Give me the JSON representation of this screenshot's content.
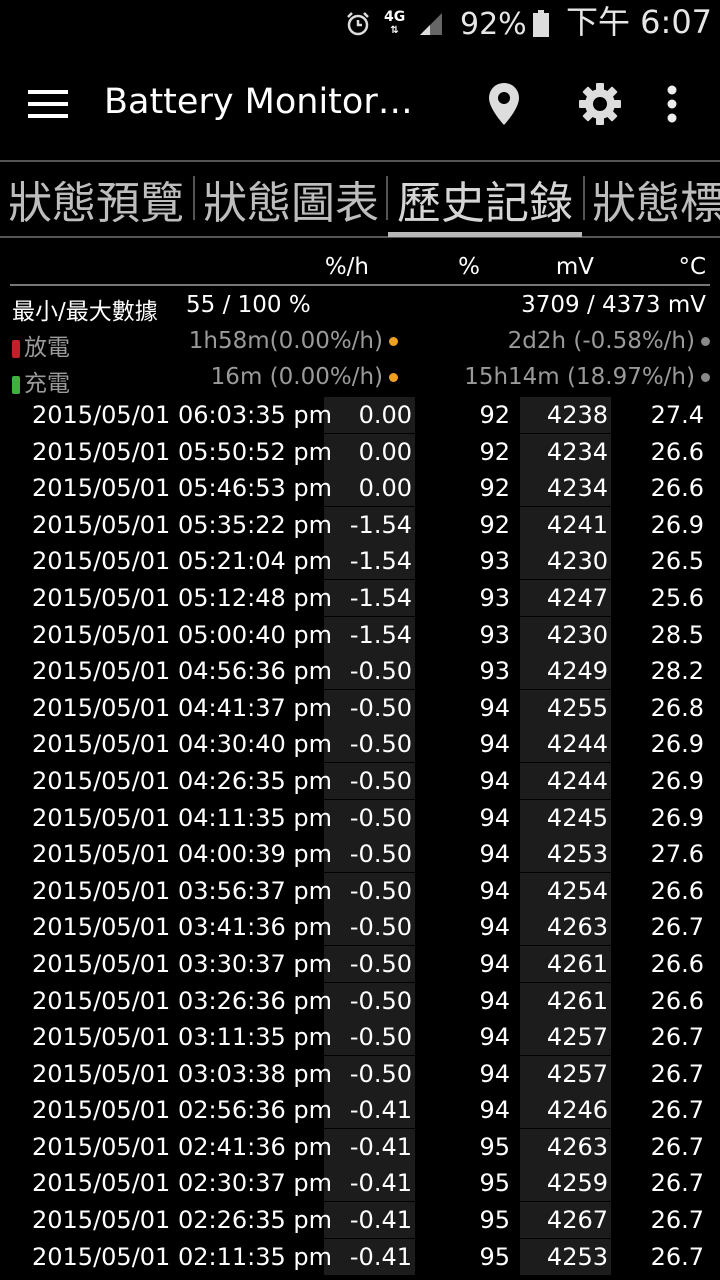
{
  "status_bar": {
    "network": "4G",
    "battery_percent": "92%",
    "time": "下午 6:07",
    "icons": [
      "alarm-icon",
      "4g-icon",
      "signal-icon",
      "battery-icon"
    ]
  },
  "app_bar": {
    "title": "Battery Monitor…",
    "icons": [
      "menu-icon",
      "location-icon",
      "settings-icon",
      "overflow-icon"
    ]
  },
  "tabs": [
    {
      "label": "狀態預覽",
      "active": false
    },
    {
      "label": "狀態圖表",
      "active": false
    },
    {
      "label": "歷史記錄",
      "active": true
    },
    {
      "label": "狀態標",
      "active": false
    }
  ],
  "columns": {
    "rate": "%/h",
    "percent": "%",
    "mv": "mV",
    "temp": "°C"
  },
  "summary": {
    "minmax_label": "最小/最大數據",
    "minmax_pct": "55 / 100 %",
    "minmax_mv": "3709 / 4373 mV",
    "discharge_label": "放電",
    "discharge_recent": "1h58m(0.00%/h)",
    "discharge_total": "2d2h (-0.58%/h)",
    "charge_label": "充電",
    "charge_recent": "16m (0.00%/h)",
    "charge_total": "15h14m (18.97%/h)"
  },
  "colors": {
    "background": "#000000",
    "cell_bg": "#1c1c1c",
    "dot_orange": "#f0a020",
    "discharge_battery": "#c0202a",
    "charge_battery": "#40b040"
  },
  "rows": [
    {
      "time": "2015/05/01 06:03:35 pm",
      "rate": "0.00",
      "pct": "92",
      "mv": "4238",
      "temp": "27.4"
    },
    {
      "time": "2015/05/01 05:50:52 pm",
      "rate": "0.00",
      "pct": "92",
      "mv": "4234",
      "temp": "26.6"
    },
    {
      "time": "2015/05/01 05:46:53 pm",
      "rate": "0.00",
      "pct": "92",
      "mv": "4234",
      "temp": "26.6"
    },
    {
      "time": "2015/05/01 05:35:22 pm",
      "rate": "-1.54",
      "pct": "92",
      "mv": "4241",
      "temp": "26.9"
    },
    {
      "time": "2015/05/01 05:21:04 pm",
      "rate": "-1.54",
      "pct": "93",
      "mv": "4230",
      "temp": "26.5"
    },
    {
      "time": "2015/05/01 05:12:48 pm",
      "rate": "-1.54",
      "pct": "93",
      "mv": "4247",
      "temp": "25.6"
    },
    {
      "time": "2015/05/01 05:00:40 pm",
      "rate": "-1.54",
      "pct": "93",
      "mv": "4230",
      "temp": "28.5"
    },
    {
      "time": "2015/05/01 04:56:36 pm",
      "rate": "-0.50",
      "pct": "93",
      "mv": "4249",
      "temp": "28.2"
    },
    {
      "time": "2015/05/01 04:41:37 pm",
      "rate": "-0.50",
      "pct": "94",
      "mv": "4255",
      "temp": "26.8"
    },
    {
      "time": "2015/05/01 04:30:40 pm",
      "rate": "-0.50",
      "pct": "94",
      "mv": "4244",
      "temp": "26.9"
    },
    {
      "time": "2015/05/01 04:26:35 pm",
      "rate": "-0.50",
      "pct": "94",
      "mv": "4244",
      "temp": "26.9"
    },
    {
      "time": "2015/05/01 04:11:35 pm",
      "rate": "-0.50",
      "pct": "94",
      "mv": "4245",
      "temp": "26.9"
    },
    {
      "time": "2015/05/01 04:00:39 pm",
      "rate": "-0.50",
      "pct": "94",
      "mv": "4253",
      "temp": "27.6"
    },
    {
      "time": "2015/05/01 03:56:37 pm",
      "rate": "-0.50",
      "pct": "94",
      "mv": "4254",
      "temp": "26.6"
    },
    {
      "time": "2015/05/01 03:41:36 pm",
      "rate": "-0.50",
      "pct": "94",
      "mv": "4263",
      "temp": "26.7"
    },
    {
      "time": "2015/05/01 03:30:37 pm",
      "rate": "-0.50",
      "pct": "94",
      "mv": "4261",
      "temp": "26.6"
    },
    {
      "time": "2015/05/01 03:26:36 pm",
      "rate": "-0.50",
      "pct": "94",
      "mv": "4261",
      "temp": "26.6"
    },
    {
      "time": "2015/05/01 03:11:35 pm",
      "rate": "-0.50",
      "pct": "94",
      "mv": "4257",
      "temp": "26.7"
    },
    {
      "time": "2015/05/01 03:03:38 pm",
      "rate": "-0.50",
      "pct": "94",
      "mv": "4257",
      "temp": "26.7"
    },
    {
      "time": "2015/05/01 02:56:36 pm",
      "rate": "-0.41",
      "pct": "94",
      "mv": "4246",
      "temp": "26.7"
    },
    {
      "time": "2015/05/01 02:41:36 pm",
      "rate": "-0.41",
      "pct": "95",
      "mv": "4263",
      "temp": "26.7"
    },
    {
      "time": "2015/05/01 02:30:37 pm",
      "rate": "-0.41",
      "pct": "95",
      "mv": "4259",
      "temp": "26.7"
    },
    {
      "time": "2015/05/01 02:26:35 pm",
      "rate": "-0.41",
      "pct": "95",
      "mv": "4267",
      "temp": "26.7"
    },
    {
      "time": "2015/05/01 02:11:35 pm",
      "rate": "-0.41",
      "pct": "95",
      "mv": "4253",
      "temp": "26.7"
    }
  ]
}
